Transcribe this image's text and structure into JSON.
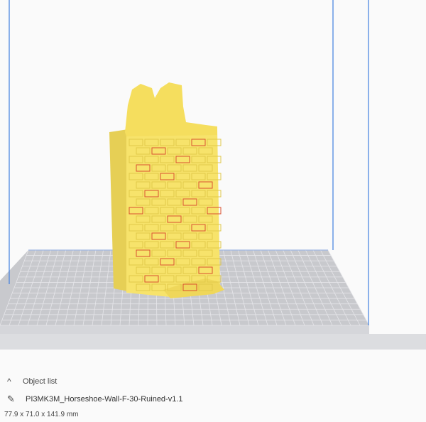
{
  "viewport": {
    "model_color": "#f7e36b",
    "model_shadow_color": "#e0c84a",
    "model_mortar_color": "#d9502f",
    "build_plate_color": "#c8c9cd",
    "grid_line_color": "#e6e6ea",
    "volume_edge_color": "#3f7fe0"
  },
  "object_panel": {
    "header_label": "Object list",
    "header_icon": "chevron-up-icon",
    "object_icon": "pencil-icon",
    "object_name": "PI3MK3M_Horseshoe-Wall-F-30-Ruined-v1.1",
    "dimensions": "77.9 x 71.0 x 141.9 mm"
  }
}
